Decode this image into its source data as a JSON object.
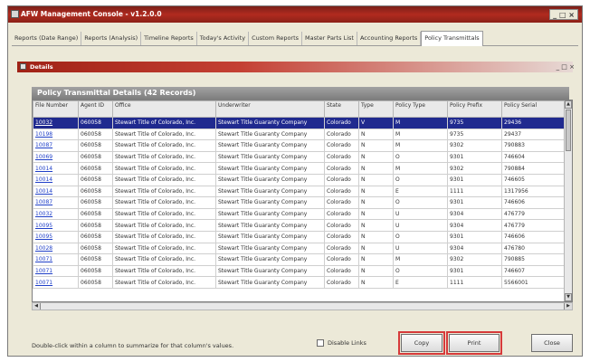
{
  "window": {
    "title": "AFW Management Console - v1.2.0.0",
    "controls": "_ □ ×"
  },
  "tabs": [
    "Reports (Date Range)",
    "Reports (Analysis)",
    "Timeline Reports",
    "Today's Activity",
    "Custom Reports",
    "Master Parts List",
    "Accounting Reports",
    "Policy Transmittals"
  ],
  "details_panel": {
    "title": "Details",
    "controls": "_ □ ×"
  },
  "grid": {
    "title": "Policy Transmittal Details (42 Records)",
    "columns": [
      "File Number",
      "Agent ID",
      "Office",
      "Underwriter",
      "State",
      "Type",
      "Policy Type",
      "Policy Prefix",
      "Policy Serial"
    ],
    "rows": [
      [
        "10032",
        "060058",
        "Stewart Title of Colorado, Inc.",
        "Stewart Title Guaranty Company",
        "Colorado",
        "V",
        "M",
        "9735",
        "29436"
      ],
      [
        "10198",
        "060058",
        "Stewart Title of Colorado, Inc.",
        "Stewart Title Guaranty Company",
        "Colorado",
        "N",
        "M",
        "9735",
        "29437"
      ],
      [
        "10087",
        "060058",
        "Stewart Title of Colorado, Inc.",
        "Stewart Title Guaranty Company",
        "Colorado",
        "N",
        "M",
        "9302",
        "790883"
      ],
      [
        "10069",
        "060058",
        "Stewart Title of Colorado, Inc.",
        "Stewart Title Guaranty Company",
        "Colorado",
        "N",
        "O",
        "9301",
        "746604"
      ],
      [
        "10014",
        "060058",
        "Stewart Title of Colorado, Inc.",
        "Stewart Title Guaranty Company",
        "Colorado",
        "N",
        "M",
        "9302",
        "790884"
      ],
      [
        "10014",
        "060058",
        "Stewart Title of Colorado, Inc.",
        "Stewart Title Guaranty Company",
        "Colorado",
        "N",
        "O",
        "9301",
        "746605"
      ],
      [
        "10014",
        "060058",
        "Stewart Title of Colorado, Inc.",
        "Stewart Title Guaranty Company",
        "Colorado",
        "N",
        "E",
        "1111",
        "1317956"
      ],
      [
        "10087",
        "060058",
        "Stewart Title of Colorado, Inc.",
        "Stewart Title Guaranty Company",
        "Colorado",
        "N",
        "O",
        "9301",
        "746606"
      ],
      [
        "10032",
        "060058",
        "Stewart Title of Colorado, Inc.",
        "Stewart Title Guaranty Company",
        "Colorado",
        "N",
        "U",
        "9304",
        "476779"
      ],
      [
        "10095",
        "060058",
        "Stewart Title of Colorado, Inc.",
        "Stewart Title Guaranty Company",
        "Colorado",
        "N",
        "U",
        "9304",
        "476779"
      ],
      [
        "10095",
        "060058",
        "Stewart Title of Colorado, Inc.",
        "Stewart Title Guaranty Company",
        "Colorado",
        "N",
        "O",
        "9301",
        "746606"
      ],
      [
        "10028",
        "060058",
        "Stewart Title of Colorado, Inc.",
        "Stewart Title Guaranty Company",
        "Colorado",
        "N",
        "U",
        "9304",
        "476780"
      ],
      [
        "10071",
        "060058",
        "Stewart Title of Colorado, Inc.",
        "Stewart Title Guaranty Company",
        "Colorado",
        "N",
        "M",
        "9302",
        "790885"
      ],
      [
        "10071",
        "060058",
        "Stewart Title of Colorado, Inc.",
        "Stewart Title Guaranty Company",
        "Colorado",
        "N",
        "O",
        "9301",
        "746607"
      ],
      [
        "10071",
        "060058",
        "Stewart Title of Colorado, Inc.",
        "Stewart Title Guaranty Company",
        "Colorado",
        "N",
        "E",
        "1111",
        "5566001"
      ]
    ],
    "selected_row": 0
  },
  "footer": {
    "hint": "Double-click within a column to summarize for that column's values.",
    "disable_links_label": "Disable Links",
    "copy_label": "Copy",
    "print_label": "Print",
    "close_label": "Close"
  },
  "colors": {
    "title_bar": "#b12a1f",
    "selected_row": "#202a8f",
    "link": "#1f3fc8",
    "highlight_outline": "#d63a3a"
  }
}
